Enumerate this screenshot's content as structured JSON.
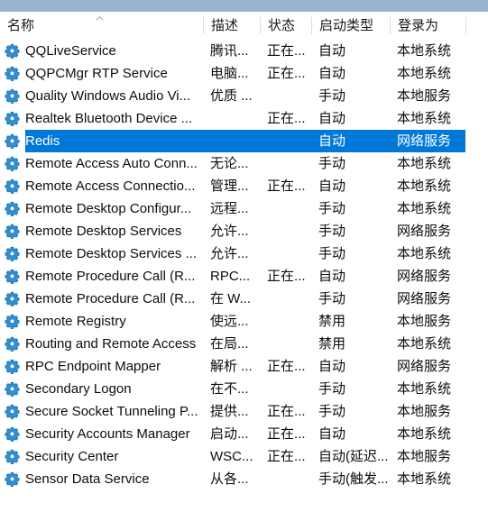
{
  "window": {
    "accent_selection_color": "#0078d7",
    "chrome_band_color": "#9bb3cd"
  },
  "columns": {
    "name": "名称",
    "description": "描述",
    "status": "状态",
    "startup_type": "启动类型",
    "log_on_as": "登录为",
    "sort_indicator": "ascending-sort-arrow",
    "sorted_by": "名称"
  },
  "rows": [
    {
      "name": "QQLiveService",
      "description": "腾讯...",
      "status": "正在...",
      "startup": "自动",
      "logon": "本地系统",
      "selected": false
    },
    {
      "name": "QQPCMgr RTP Service",
      "description": "电脑...",
      "status": "正在...",
      "startup": "自动",
      "logon": "本地系统",
      "selected": false
    },
    {
      "name": "Quality Windows Audio Vi...",
      "description": "优质 ...",
      "status": "",
      "startup": "手动",
      "logon": "本地服务",
      "selected": false
    },
    {
      "name": "Realtek Bluetooth Device ...",
      "description": "",
      "status": "正在...",
      "startup": "自动",
      "logon": "本地系统",
      "selected": false
    },
    {
      "name": "Redis",
      "description": "",
      "status": "",
      "startup": "自动",
      "logon": "网络服务",
      "selected": true
    },
    {
      "name": "Remote Access Auto Conn...",
      "description": "无论...",
      "status": "",
      "startup": "手动",
      "logon": "本地系统",
      "selected": false
    },
    {
      "name": "Remote Access Connectio...",
      "description": "管理...",
      "status": "正在...",
      "startup": "自动",
      "logon": "本地系统",
      "selected": false
    },
    {
      "name": "Remote Desktop Configur...",
      "description": "远程...",
      "status": "",
      "startup": "手动",
      "logon": "本地系统",
      "selected": false
    },
    {
      "name": "Remote Desktop Services",
      "description": "允许...",
      "status": "",
      "startup": "手动",
      "logon": "网络服务",
      "selected": false
    },
    {
      "name": "Remote Desktop Services ...",
      "description": "允许...",
      "status": "",
      "startup": "手动",
      "logon": "本地系统",
      "selected": false
    },
    {
      "name": "Remote Procedure Call (R...",
      "description": "RPC...",
      "status": "正在...",
      "startup": "自动",
      "logon": "网络服务",
      "selected": false
    },
    {
      "name": "Remote Procedure Call (R...",
      "description": "在 W...",
      "status": "",
      "startup": "手动",
      "logon": "网络服务",
      "selected": false
    },
    {
      "name": "Remote Registry",
      "description": "使远...",
      "status": "",
      "startup": "禁用",
      "logon": "本地服务",
      "selected": false
    },
    {
      "name": "Routing and Remote Access",
      "description": "在局...",
      "status": "",
      "startup": "禁用",
      "logon": "本地系统",
      "selected": false
    },
    {
      "name": "RPC Endpoint Mapper",
      "description": "解析 ...",
      "status": "正在...",
      "startup": "自动",
      "logon": "网络服务",
      "selected": false
    },
    {
      "name": "Secondary Logon",
      "description": "在不...",
      "status": "",
      "startup": "手动",
      "logon": "本地系统",
      "selected": false
    },
    {
      "name": "Secure Socket Tunneling P...",
      "description": "提供...",
      "status": "正在...",
      "startup": "手动",
      "logon": "本地服务",
      "selected": false
    },
    {
      "name": "Security Accounts Manager",
      "description": "启动...",
      "status": "正在...",
      "startup": "自动",
      "logon": "本地系统",
      "selected": false
    },
    {
      "name": "Security Center",
      "description": "WSC...",
      "status": "正在...",
      "startup": "自动(延迟...",
      "logon": "本地服务",
      "selected": false
    },
    {
      "name": "Sensor Data Service",
      "description": "从各...",
      "status": "",
      "startup": "手动(触发...",
      "logon": "本地系统",
      "selected": false
    }
  ]
}
